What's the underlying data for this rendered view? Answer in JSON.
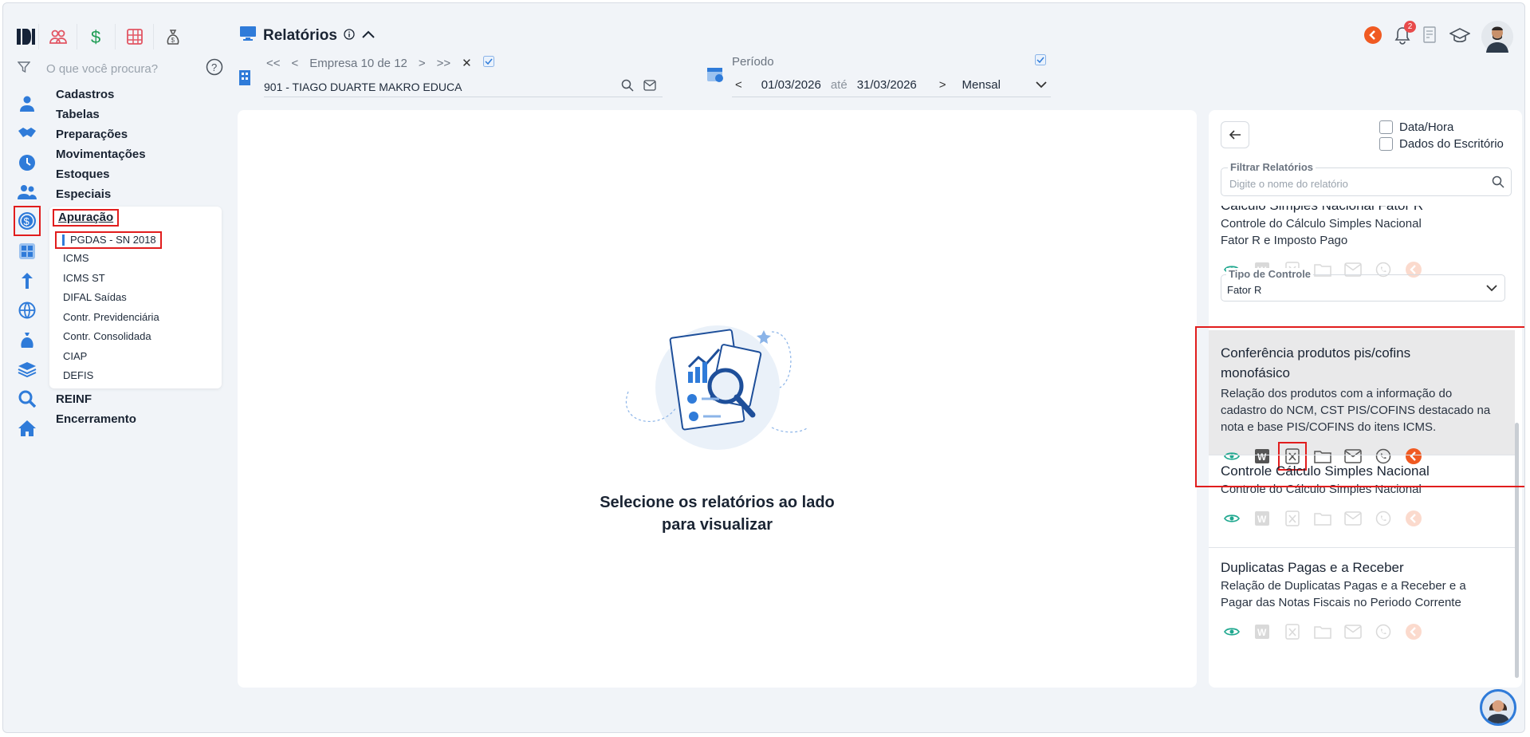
{
  "header": {
    "title": "Relatórios",
    "company_nav": {
      "first": "<<",
      "prev": "<",
      "label": "Empresa 10 de 12",
      "next": ">",
      "last": ">>",
      "close": "✕"
    },
    "company_name": "901 - TIAGO DUARTE MAKRO EDUCA",
    "periodo": {
      "label": "Período",
      "prev": "<",
      "start": "01/03/2026",
      "until": "até",
      "end": "31/03/2026",
      "next": ">",
      "mode": "Mensal"
    },
    "notification_count": "2"
  },
  "search": {
    "placeholder": "O que você procura?"
  },
  "menu": {
    "items": [
      "Cadastros",
      "Tabelas",
      "Preparações",
      "Movimentações",
      "Estoques",
      "Especiais"
    ],
    "apuracao": "Apuração",
    "submenu": [
      "PGDAS - SN 2018",
      "ICMS",
      "ICMS ST",
      "DIFAL Saídas",
      "Contr. Previdenciária",
      "Contr. Consolidada",
      "CIAP",
      "DEFIS"
    ],
    "after": [
      "REINF",
      "Encerramento"
    ]
  },
  "main": {
    "empty_line1": "Selecione os relatórios ao lado",
    "empty_line2": "para visualizar"
  },
  "right_panel": {
    "check_datahora": "Data/Hora",
    "check_dados": "Dados do Escritório",
    "filter_label": "Filtrar Relatórios",
    "filter_placeholder": "Digite o nome do relatório",
    "reports": [
      {
        "title": "Cálculo Simples Nacional Fator R",
        "desc": "Controle do Cálculo Simples Nacional Fator R e Imposto Pago"
      },
      {
        "title": "Conferência produtos pis/cofins monofásico",
        "desc": "Relação dos produtos com a informação do cadastro do NCM, CST PIS/COFINS destacado na nota e base PIS/COFINS do itens ICMS."
      },
      {
        "title": "Controle Cálculo Simples Nacional",
        "desc": "Controle do Cálculo Simples Nacional"
      },
      {
        "title": "Duplicatas Pagas e a Receber",
        "desc": "Relação de Duplicatas Pagas e a Receber e a Pagar das Notas Fiscais no Periodo Corrente"
      }
    ],
    "tipo_controle": {
      "label": "Tipo de Controle",
      "value": "Fator R"
    }
  },
  "colors": {
    "accent_red": "#e11d1d",
    "brand_blue": "#2f7bd9",
    "eye_green": "#1fa88f",
    "orange": "#f05a22"
  }
}
